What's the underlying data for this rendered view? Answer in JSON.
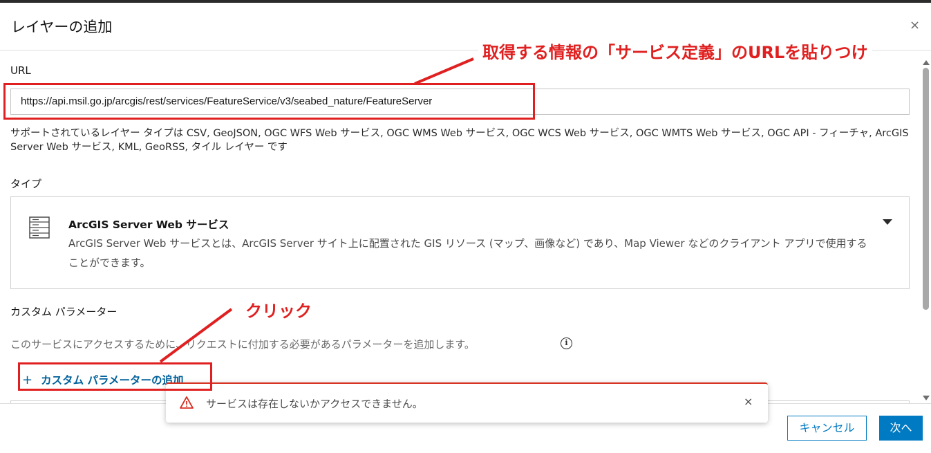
{
  "dialog": {
    "title": "レイヤーの追加",
    "close_glyph": "×"
  },
  "url_section": {
    "label": "URL",
    "value": "https://api.msil.go.jp/arcgis/rest/services/FeatureService/v3/seabed_nature/FeatureServer",
    "hint": "サポートされているレイヤー タイプは CSV, GeoJSON, OGC WFS Web サービス, OGC WMS Web サービス, OGC WCS Web サービス, OGC WMTS Web サービス, OGC API - フィーチャ, ArcGIS Server Web サービス, KML, GeoRSS, タイル レイヤー です"
  },
  "type_section": {
    "label": "タイプ",
    "selected_name": "ArcGIS Server Web サービス",
    "selected_desc": "ArcGIS Server Web サービスとは、ArcGIS Server サイト上に配置された GIS リソース (マップ、画像など) であり、Map Viewer などのクライアント アプリで使用することができます。",
    "icon": "server-icon"
  },
  "custom_params": {
    "label": "カスタム パラメーター",
    "description": "このサービスにアクセスするために、リクエストに付加する必要があるパラメーターを追加します。",
    "info_glyph": "i",
    "add_plus": "+",
    "add_label": "カスタム パラメーターの追加"
  },
  "toast": {
    "message": "サービスは存在しないかアクセスできません。",
    "icon": "warning-triangle-icon",
    "close_glyph": "×",
    "accent": "#d83020"
  },
  "footer": {
    "cancel_label": "キャンセル",
    "next_label": "次へ"
  },
  "annotations": {
    "url_note": "取得する情報の「サービス定義」のURLを貼りつけ",
    "click_note": "クリック",
    "color": "#e02020"
  },
  "colors": {
    "accent": "#007ac2",
    "link": "#00619b"
  }
}
